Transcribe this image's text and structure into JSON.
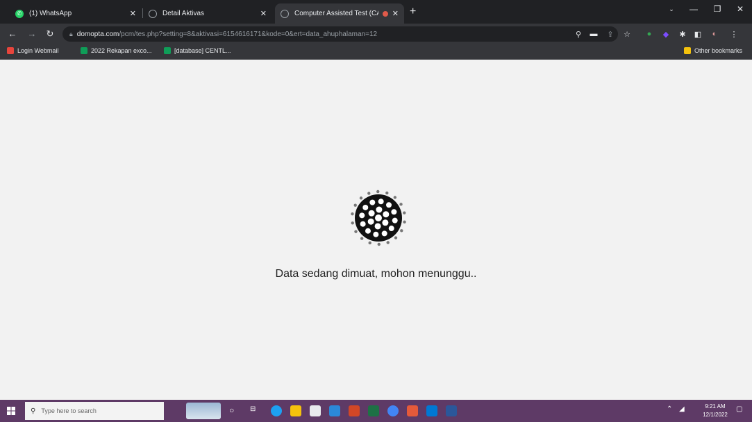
{
  "browser": {
    "tabs": [
      {
        "title": "(1) WhatsApp",
        "favicon": "whatsapp-icon",
        "color": "#25d366",
        "active": false
      },
      {
        "title": "Detail Aktivas",
        "favicon": "globe-icon",
        "color": "#9aa0a6",
        "active": false
      },
      {
        "title": "Computer Assisted Test (CAT)",
        "favicon": "globe-icon",
        "color": "#9aa0a6",
        "active": true
      }
    ],
    "new_tab": "+",
    "window_controls": {
      "minimize": "—",
      "maximize": "❐",
      "close": "✕"
    },
    "url_host": "domopta.com",
    "url_path": "/pcm/tes.php?setting=8&aktivasi=6154616171&kode=0&ert=data_ahuphalaman=12",
    "bookmarks": [
      {
        "label": "Login Webmail",
        "color": "#e8453c"
      },
      {
        "label": "2022 Rekapan exco...",
        "color": "#0f9d58"
      },
      {
        "label": "[database] CENTL...",
        "color": "#0f9d58"
      }
    ],
    "other_bookmarks": "Other bookmarks"
  },
  "page": {
    "loading_message": "Data sedang dimuat, mohon menunggu.."
  },
  "taskbar": {
    "search_placeholder": "Type here to search",
    "time": "9:21 AM",
    "date": "12/1/2022"
  },
  "colors": {
    "tabstrip": "#202124",
    "toolbar": "#35363a",
    "page_bg": "#f2f2f2",
    "taskbar": "#5e3a66"
  }
}
